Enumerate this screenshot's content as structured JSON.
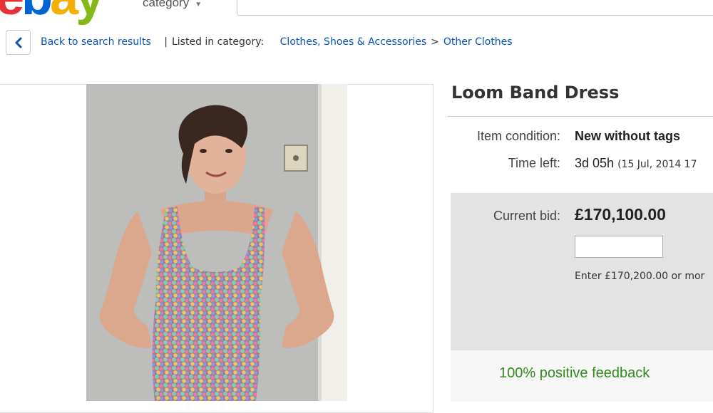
{
  "header": {
    "logo_text": "ebay",
    "category_label": "category",
    "search_value": ""
  },
  "breadcrumb": {
    "back_label": "Back to search results",
    "listed_in_label": "Listed in category:",
    "category_path": [
      "Clothes, Shoes & Accessories",
      "Other Clothes"
    ],
    "separator": ">"
  },
  "item": {
    "title": "Loom Band Dress",
    "condition_label": "Item condition:",
    "condition_value": "New without tags",
    "time_left_label": "Time left:",
    "time_left_value": "3d 05h",
    "time_left_detail": "(15 Jul, 2014  17"
  },
  "bid": {
    "current_bid_label": "Current bid:",
    "current_bid_value": "£170,100.00",
    "bid_input_value": "",
    "bid_hint": "Enter £170,200.00 or mor"
  },
  "seller": {
    "feedback": "100% positive feedback"
  },
  "colors": {
    "link": "#0654ba",
    "feedback_green": "#2f8a1b",
    "bid_panel_bg": "#e3e3e3"
  }
}
